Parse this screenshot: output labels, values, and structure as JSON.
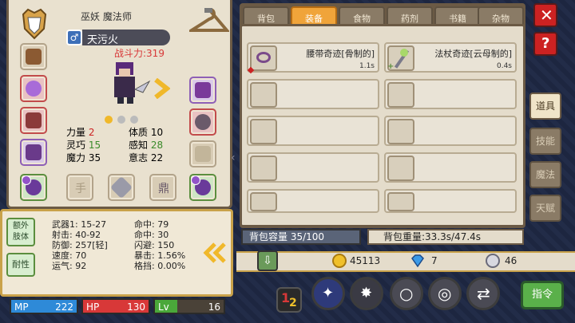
{
  "character": {
    "title": "巫妖 魔法师",
    "name": "天污火",
    "power": "战斗力:319"
  },
  "attributes": [
    {
      "label": "力量",
      "value": "2",
      "color": "#c22"
    },
    {
      "label": "体质",
      "value": "10",
      "color": "#222"
    },
    {
      "label": "灵巧",
      "value": "15",
      "color": "#3a8a2a"
    },
    {
      "label": "感知",
      "value": "28",
      "color": "#3a8a2a"
    },
    {
      "label": "魔力",
      "value": "35",
      "color": "#222"
    },
    {
      "label": "意志",
      "value": "22",
      "color": "#222"
    }
  ],
  "empty_slot_labels": {
    "hand": "手",
    "gear": "鼎"
  },
  "stat_tabs": {
    "extra": "额外\n肢体",
    "resist": "耐性"
  },
  "combat_stats": {
    "left": [
      "武器1: 15-27",
      "射击: 40-92",
      "防御: 257[轻]",
      "速度: 70",
      "运气: 92"
    ],
    "right": [
      "命中: 79",
      "命中: 30",
      "闪避: 150",
      "暴击: 1.56%",
      "格挡: 0.00%"
    ]
  },
  "bars": {
    "mp_label": "MP",
    "mp": "222",
    "hp_label": "HP",
    "hp": "130",
    "lv_label": "Lv",
    "lv": "16"
  },
  "tabs": [
    "背包",
    "装备",
    "食物",
    "药剂",
    "书籍",
    "杂物"
  ],
  "active_tab": 1,
  "items": [
    {
      "name": "腰带奇迹[骨制的]",
      "weight": "1.1s"
    },
    {
      "name": "法杖奇迹[云母制的]",
      "weight": "0.4s"
    }
  ],
  "capacity": "背包容量 35/100",
  "weight": "背包重量:33.3s/47.4s",
  "currency": {
    "gold": "45113",
    "gem": "7",
    "silver": "46"
  },
  "side_tabs": [
    "道具",
    "技能",
    "魔法",
    "天赋"
  ],
  "command": "指令",
  "colors": {
    "accent": "#f0a43a",
    "mp": "#2e8ad8",
    "hp": "#d83838",
    "lv": "#4aa83a"
  }
}
